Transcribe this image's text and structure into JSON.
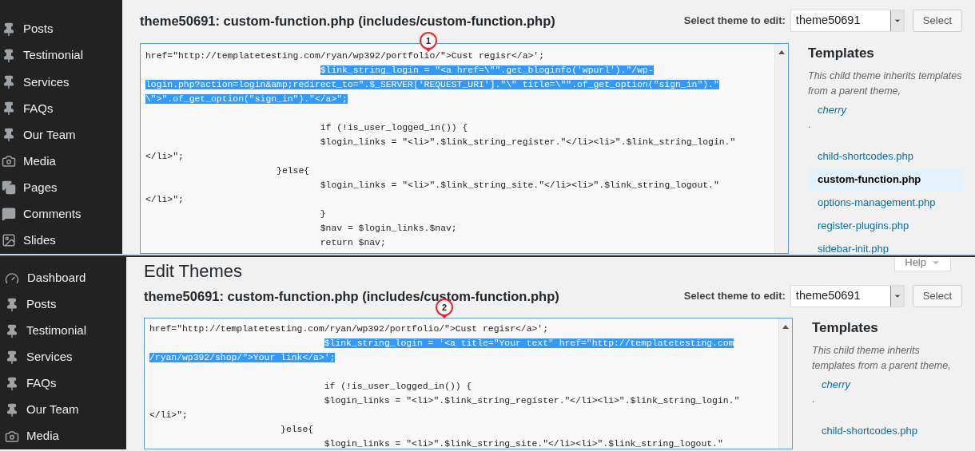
{
  "screenshots": [
    {
      "callout": "1",
      "sidebar": [
        {
          "label": "Posts",
          "kind": "pin"
        },
        {
          "label": "Testimonial",
          "kind": "pin"
        },
        {
          "label": "Services",
          "kind": "pin"
        },
        {
          "label": "FAQs",
          "kind": "pin"
        },
        {
          "label": "Our Team",
          "kind": "pin"
        },
        {
          "label": "Media",
          "kind": "media"
        },
        {
          "label": "Pages",
          "kind": "pages"
        },
        {
          "label": "Comments",
          "kind": "comments"
        },
        {
          "label": "Slides",
          "kind": "slides"
        }
      ],
      "file_heading": "theme50691: custom-function.php (includes/custom-function.php)",
      "theme_select": {
        "label": "Select theme to edit:",
        "value": "theme50691"
      },
      "select_button": "Select",
      "code_lines": [
        {
          "kind": "code",
          "text": "href=\"http://templatetesting.com/ryan/wp392/portfolio/\">Cust regisr</a>';",
          "selected": false
        },
        {
          "kind": "code",
          "text": "\t\t\t\t$link_string_login = \"<a href=\\\"\".get_bloginfo('wpurl').\"/wp-",
          "selected": true
        },
        {
          "kind": "code",
          "text": "login.php?action=login&amp;redirect_to=\".$_SERVER['REQUEST_URI'].\"\\\" title=\\\"\".of_get_option(\"sign_in\").\"",
          "selected": true
        },
        {
          "kind": "code",
          "text": "\\\">\".of_get_option(\"sign_in\").\"</a>\";",
          "selected": true
        },
        {
          "kind": "blank"
        },
        {
          "kind": "code",
          "text": "\t\t\t\tif (!is_user_logged_in()) {",
          "selected": false
        },
        {
          "kind": "code",
          "text": "\t\t\t\t$login_links = \"<li>\".$link_string_register.\"</li><li>\".$link_string_login.\"",
          "selected": false
        },
        {
          "kind": "code",
          "text": "</li>\";",
          "selected": false
        },
        {
          "kind": "code",
          "text": "\t\t\t}else{",
          "selected": false
        },
        {
          "kind": "code",
          "text": "\t\t\t\t$login_links = \"<li>\".$link_string_site.\"</li><li>\".$link_string_logout.\"",
          "selected": false
        },
        {
          "kind": "code",
          "text": "</li>\";",
          "selected": false
        },
        {
          "kind": "code",
          "text": "\t\t\t\t}",
          "selected": false
        },
        {
          "kind": "code",
          "text": "\t\t\t\t$nav = $login_links.$nav;",
          "selected": false
        },
        {
          "kind": "code",
          "text": "\t\t\t\treturn $nav;",
          "selected": false
        }
      ],
      "templates": {
        "title": "Templates",
        "description": "This child theme inherits templates from a parent theme,",
        "parent_link": "cherry",
        "separator": ".",
        "files": [
          {
            "name": "child-shortcodes.php",
            "selected": false
          },
          {
            "name": "custom-function.php",
            "selected": true
          },
          {
            "name": "options-management.php",
            "selected": false
          },
          {
            "name": "register-plugins.php",
            "selected": false
          },
          {
            "name": "sidebar-init.php",
            "selected": false
          }
        ]
      }
    },
    {
      "callout": "2",
      "help_button": "Help",
      "page_title": "Edit Themes",
      "sidebar": [
        {
          "label": "Dashboard",
          "kind": "dashboard"
        },
        {
          "label": "Posts",
          "kind": "pin"
        },
        {
          "label": "Testimonial",
          "kind": "pin"
        },
        {
          "label": "Services",
          "kind": "pin"
        },
        {
          "label": "FAQs",
          "kind": "pin"
        },
        {
          "label": "Our Team",
          "kind": "pin"
        },
        {
          "label": "Media",
          "kind": "media"
        }
      ],
      "file_heading": "theme50691: custom-function.php (includes/custom-function.php)",
      "theme_select": {
        "label": "Select theme to edit:",
        "value": "theme50691"
      },
      "select_button": "Select",
      "code_lines": [
        {
          "kind": "code",
          "text": "href=\"http://templatetesting.com/ryan/wp392/portfolio/\">Cust regisr</a>';",
          "selected": false
        },
        {
          "kind": "code",
          "text": "\t\t\t\t$link_string_login = '<a title=\"Your text\" href=\"http://templatetesting.com",
          "selected": true
        },
        {
          "kind": "code",
          "text": "/ryan/wp392/shop/\">Your link</a>';",
          "selected": true
        },
        {
          "kind": "blank"
        },
        {
          "kind": "code",
          "text": "\t\t\t\tif (!is_user_logged_in()) {",
          "selected": false
        },
        {
          "kind": "code",
          "text": "\t\t\t\t$login_links = \"<li>\".$link_string_register.\"</li><li>\".$link_string_login.\"",
          "selected": false
        },
        {
          "kind": "code",
          "text": "</li>\";",
          "selected": false
        },
        {
          "kind": "code",
          "text": "\t\t\t}else{",
          "selected": false
        },
        {
          "kind": "code",
          "text": "\t\t\t\t$login_links = \"<li>\".$link_string_site.\"</li><li>\".$link_string_logout.\"",
          "selected": false
        }
      ],
      "templates": {
        "title": "Templates",
        "description": "This child theme inherits templates from a parent theme,",
        "parent_link": "cherry",
        "separator": ".",
        "files": [
          {
            "name": "child-shortcodes.php",
            "selected": false
          }
        ]
      }
    }
  ]
}
